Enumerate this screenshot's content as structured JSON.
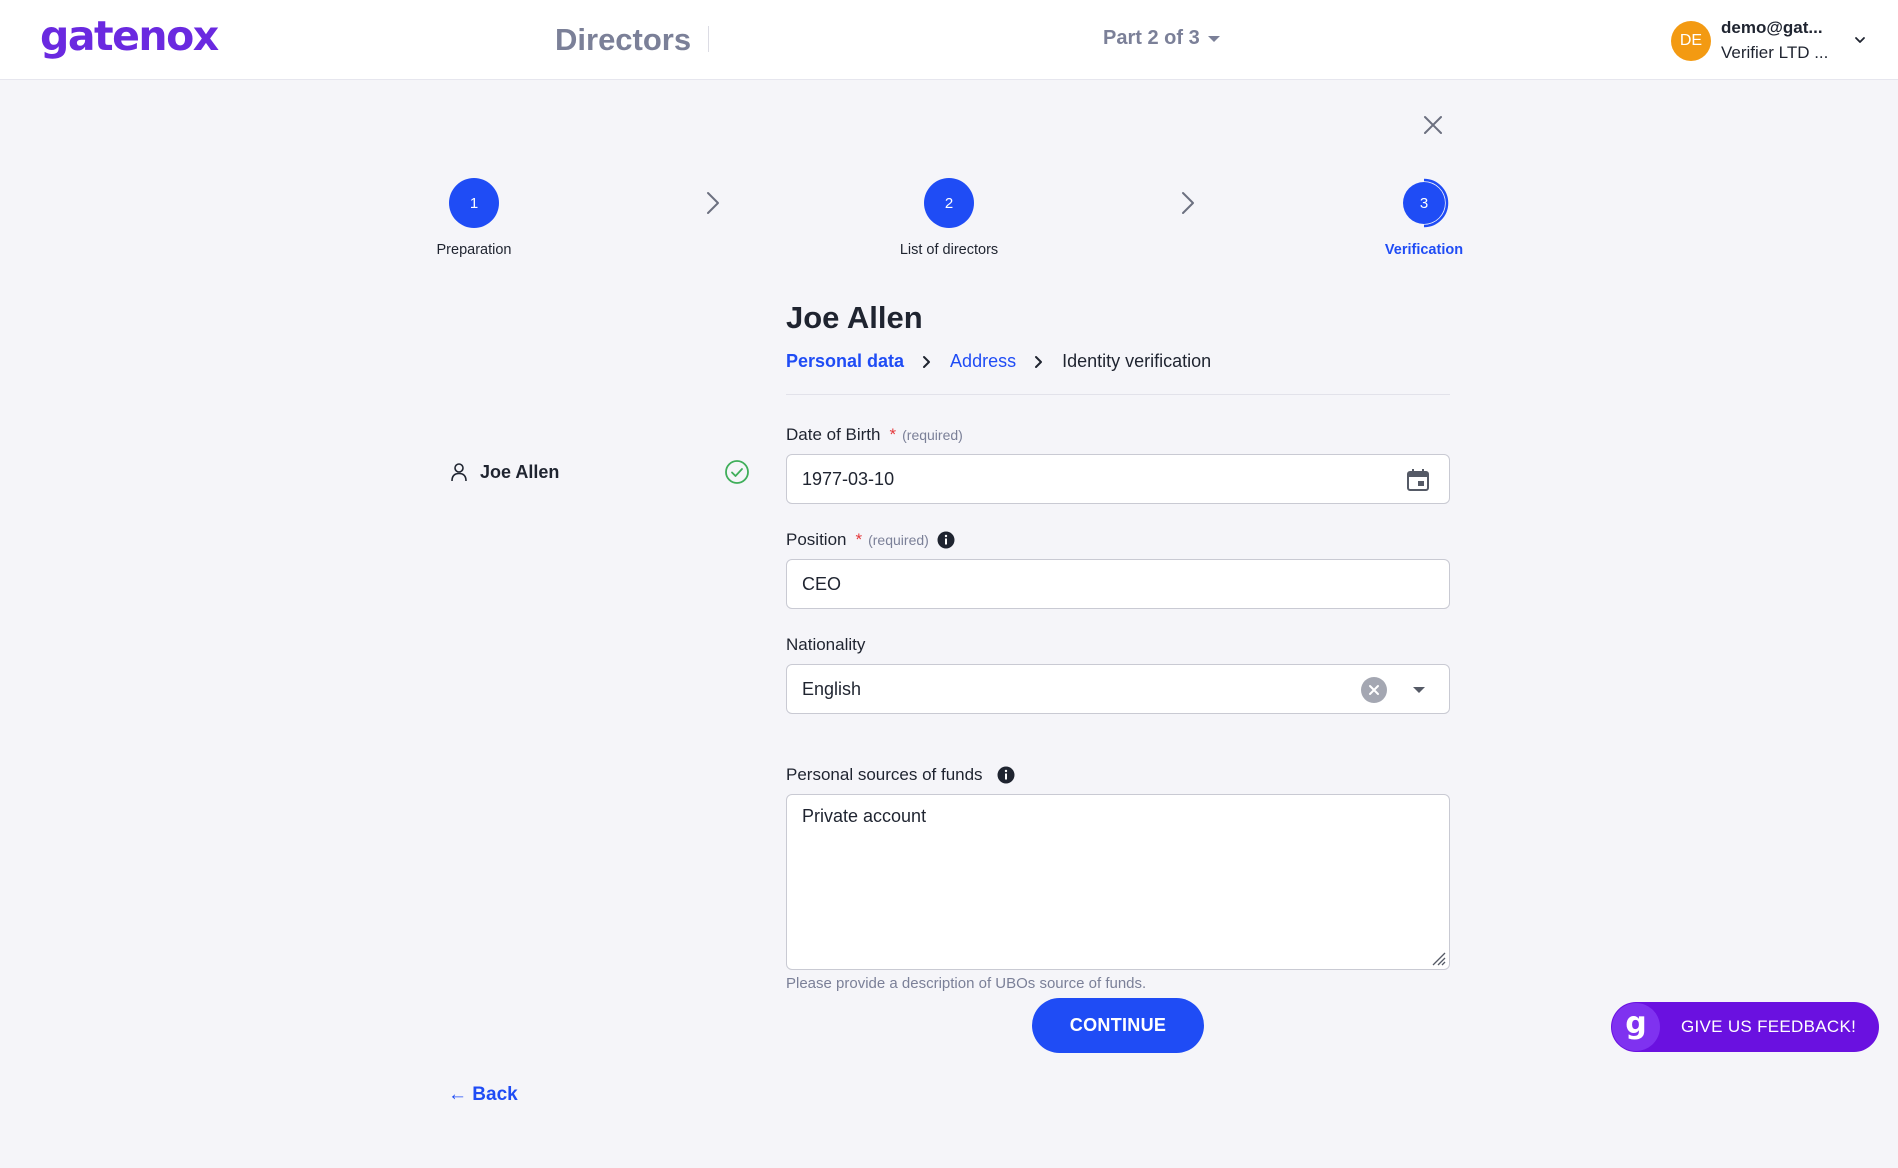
{
  "header": {
    "logo": "gatenox",
    "page_title": "Directors",
    "part_selector": "Part 2 of 3",
    "user": {
      "avatar_initials": "DE",
      "email": "demo@gat...",
      "company": "Verifier LTD ..."
    }
  },
  "stepper": {
    "steps": [
      {
        "number": "1",
        "label": "Preparation",
        "state": "done"
      },
      {
        "number": "2",
        "label": "List of directors",
        "state": "done"
      },
      {
        "number": "3",
        "label": "Verification",
        "state": "current"
      }
    ]
  },
  "sidebar": {
    "directors": [
      {
        "name": "Joe Allen",
        "status": "complete"
      }
    ]
  },
  "form": {
    "person_name": "Joe Allen",
    "breadcrumb": [
      "Personal data",
      "Address",
      "Identity verification"
    ],
    "date_of_birth": {
      "label": "Date of Birth",
      "required_mark": "*",
      "required_text": "(required)",
      "value": "1977-03-10"
    },
    "position": {
      "label": "Position",
      "required_mark": "*",
      "required_text": "(required)",
      "value": "CEO"
    },
    "nationality": {
      "label": "Nationality",
      "value": "English"
    },
    "sources_of_funds": {
      "label": "Personal sources of funds",
      "value": "Private account",
      "helper": "Please provide a description of UBOs source of funds."
    },
    "continue_label": "CONTINUE",
    "back_label": "← Back"
  },
  "feedback": {
    "label": "GIVE US FEEDBACK!",
    "logo_letter": "g"
  },
  "colors": {
    "primary": "#1f4cf5",
    "brand": "#6a29e0",
    "avatar": "#f39a12",
    "success": "#3fae5a",
    "required": "#e5383b"
  }
}
